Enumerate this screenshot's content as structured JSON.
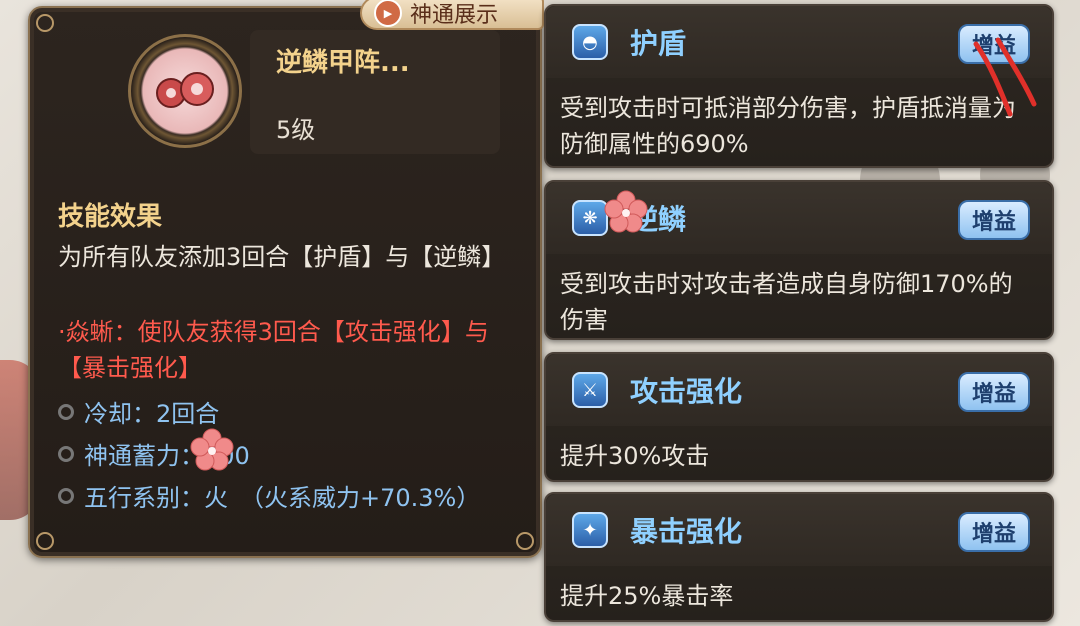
{
  "skill": {
    "showcase_label": "神通展示",
    "name": "逆鳞甲阵...",
    "level": "5级",
    "section_title": "技能效果",
    "description": "为所有队友添加3回合【护盾】与【逆鳞】",
    "bonus_effect": "·焱蜥：使队友获得3回合【攻击强化】与【暴击强化】",
    "stats": [
      {
        "icon": "spiral-bullet-icon",
        "text": "冷却：2回合"
      },
      {
        "icon": "spiral-bullet-icon",
        "text": "神通蓄力：700"
      },
      {
        "icon": "spiral-bullet-icon",
        "text": "五行系别：火　（火系威力+70.3%）"
      }
    ]
  },
  "buffs": [
    {
      "icon": "shield-icon",
      "title": "护盾",
      "badge": "增益",
      "description": "受到攻击时可抵消部分伤害，护盾抵消量为防御属性的690%"
    },
    {
      "icon": "reverse-scale-icon",
      "title": "逆鳞",
      "badge": "增益",
      "description": "受到攻击时对攻击者造成自身防御170%的伤害"
    },
    {
      "icon": "sword-icon",
      "title": "攻击强化",
      "badge": "增益",
      "description": "提升30%攻击"
    },
    {
      "icon": "crit-icon",
      "title": "暴击强化",
      "badge": "增益",
      "description": "提升25%暴击率"
    }
  ],
  "colors": {
    "gold": "#f3d28c",
    "red_effect": "#ff5a4d",
    "stat_blue": "#8fc3f0",
    "buff_title": "#8fd0ff"
  }
}
